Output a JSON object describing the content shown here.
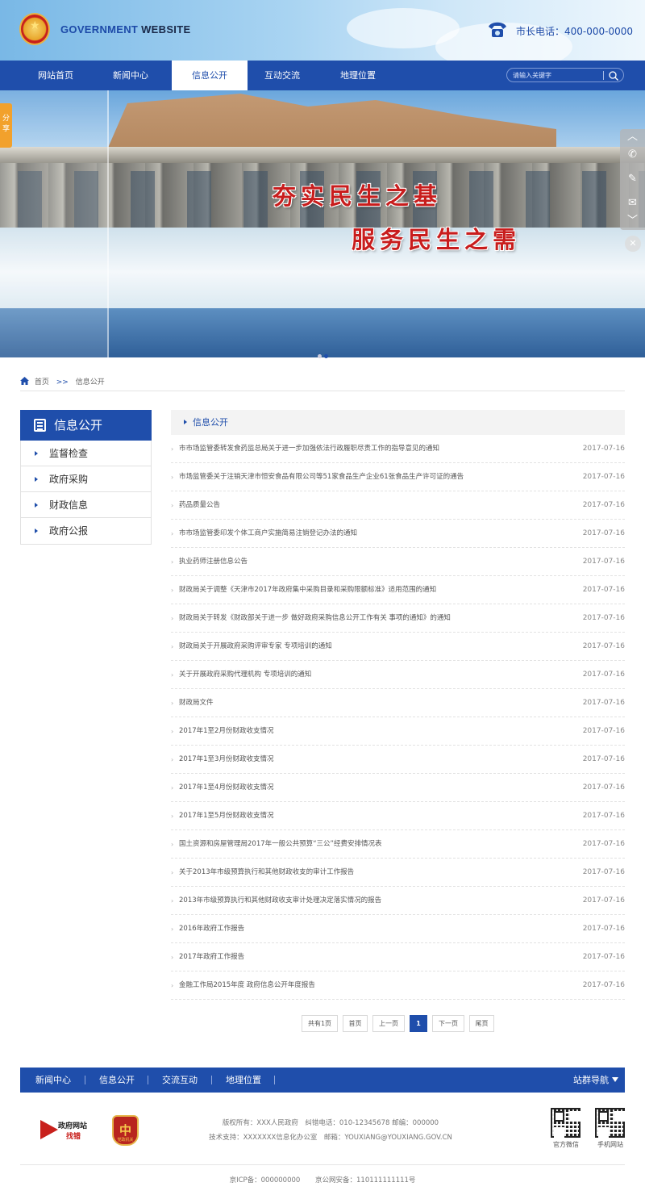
{
  "header": {
    "title_prefix": "GOVERNMENT",
    "title_suffix": "WEBSITE",
    "hotline": "市长电话：400-000-0000"
  },
  "nav": {
    "items": [
      "网站首页",
      "新闻中心",
      "信息公开",
      "互动交流",
      "地理位置"
    ],
    "active": "信息公开",
    "search_placeholder": "请输入关键字"
  },
  "banner": {
    "slogan_1": "夯实民生之基",
    "slogan_2": "服务民生之需",
    "share_label": "分享",
    "slide_count": 2,
    "active_slide": 2
  },
  "breadcrumb": {
    "home": "首页",
    "separator": ">>",
    "current": "信息公开"
  },
  "sidebar": {
    "title": "信息公开",
    "items": [
      "监督检查",
      "政府采购",
      "财政信息",
      "政府公报"
    ]
  },
  "main": {
    "section_title": "信息公开",
    "articles": [
      {
        "title": "市市场监管委转发食药监总局关于进一步加强依法行政履职尽责工作的指导意见的通知",
        "date": "2017-07-16"
      },
      {
        "title": "市场监管委关于注销天津市恒安食品有限公司等51家食品生产企业61张食品生产许可证的通告",
        "date": "2017-07-16"
      },
      {
        "title": "药品质量公告",
        "date": "2017-07-16"
      },
      {
        "title": "市市场监管委印发个体工商户实施简易注销登记办法的通知",
        "date": "2017-07-16"
      },
      {
        "title": "执业药师注册信息公告",
        "date": "2017-07-16"
      },
      {
        "title": "财政局关于调整《天津市2017年政府集中采购目录和采购限额标准》适用范围的通知",
        "date": "2017-07-16"
      },
      {
        "title": "财政局关于转发《财政部关于进一步 做好政府采购信息公开工作有关 事项的通知》的通知",
        "date": "2017-07-16"
      },
      {
        "title": "财政局关于开展政府采购评审专家 专项培训的通知",
        "date": "2017-07-16"
      },
      {
        "title": "关于开展政府采购代理机构 专项培训的通知",
        "date": "2017-07-16"
      },
      {
        "title": "财政局文件",
        "date": "2017-07-16"
      },
      {
        "title": "2017年1至2月份财政收支情况",
        "date": "2017-07-16"
      },
      {
        "title": "2017年1至3月份财政收支情况",
        "date": "2017-07-16"
      },
      {
        "title": "2017年1至4月份财政收支情况",
        "date": "2017-07-16"
      },
      {
        "title": "2017年1至5月份财政收支情况",
        "date": "2017-07-16"
      },
      {
        "title": "国土资源和房屋管理局2017年一般公共预算“三公”经费安排情况表",
        "date": "2017-07-16"
      },
      {
        "title": "关于2013年市级预算执行和其他财政收支的审计工作报告",
        "date": "2017-07-16"
      },
      {
        "title": "2013年市级预算执行和其他财政收支审计处理决定落实情况的报告",
        "date": "2017-07-16"
      },
      {
        "title": "2016年政府工作报告",
        "date": "2017-07-16"
      },
      {
        "title": "2017年政府工作报告",
        "date": "2017-07-16"
      },
      {
        "title": "金融工作局2015年度 政府信息公开年度报告",
        "date": "2017-07-16"
      }
    ]
  },
  "pagination": {
    "total": "共有1页",
    "first": "首页",
    "prev": "上一页",
    "current": "1",
    "next": "下一页",
    "last": "尾页"
  },
  "footer": {
    "nav": [
      "新闻中心",
      "信息公开",
      "交流互动",
      "地理位置"
    ],
    "site_nav": "站群导航",
    "logo1_line1": "政府网站",
    "logo1_line2": "找错",
    "logo2_label": "党政机关",
    "copyright": "版权所有：XXX人民政府　纠错电话：010-12345678  邮编：000000",
    "support": "技术支持：XXXXXXX信息化办公室　邮箱：YOUXIANG@YOUXIANG.GOV.CN",
    "qr1_label": "官方微信",
    "qr2_label": "手机网站",
    "icp": "京ICP备：000000000",
    "police": "京公网安备：110111111111号"
  },
  "colors": {
    "brand_blue": "#1f4eab",
    "slogan_red": "#c81d1d",
    "share_orange": "#f2a12c"
  }
}
